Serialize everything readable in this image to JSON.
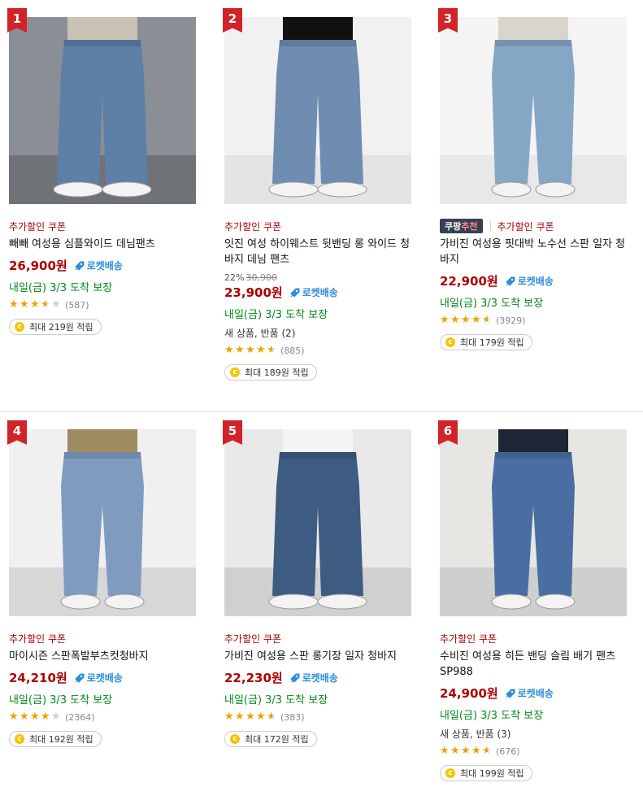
{
  "colors": {
    "rank_flag": "#d2232a",
    "coupon": "#ae0000",
    "price": "#ae0000",
    "rocket": "#2d8ed8",
    "arrive": "#00891a",
    "star": "#f0a100",
    "rec_badge": "#374151"
  },
  "products": [
    {
      "rank": "1",
      "coupon": "추가할인 쿠폰",
      "name": "빼빼 여성용 심플와이드 데님팬츠",
      "price": "26,900원",
      "rocket": "로켓배송",
      "arrive": "내일(금) 3/3 도착 보장",
      "rating": 3.5,
      "count": "(587)",
      "reward": "최대 219원 적립",
      "image": "wide-jeans-photo"
    },
    {
      "rank": "2",
      "coupon": "추가할인 쿠폰",
      "name": "잇진 여성 하이웨스트 뒷밴딩 롱 와이드 청바지 데님 팬츠",
      "discount": "22%",
      "orig_price": "30,900",
      "price": "23,900원",
      "rocket": "로켓배송",
      "arrive": "내일(금) 3/3 도착 보장",
      "new_prod": "새 상품, 반품 (2)",
      "rating": 4.5,
      "count": "(885)",
      "reward": "최대 189원 적립",
      "image": "highwaist-jeans-photo"
    },
    {
      "rank": "3",
      "rec": "쿠팡추천",
      "rec_a": "쿠팡",
      "rec_b": "추천",
      "coupon": "추가할인 쿠폰",
      "name": "가비진 여성용 핏대박 노수선 스판 일자 청바지",
      "price": "22,900원",
      "rocket": "로켓배송",
      "arrive": "내일(금) 3/3 도착 보장",
      "rating": 4.5,
      "count": "(3929)",
      "reward": "최대 179원 적립",
      "image": "straight-jeans-photo"
    },
    {
      "rank": "4",
      "coupon": "추가할인 쿠폰",
      "name": "마이시즌 스판폭발부츠컷청바지",
      "price": "24,210원",
      "rocket": "로켓배송",
      "arrive": "내일(금) 3/3 도착 보장",
      "rating": 4,
      "count": "(2364)",
      "reward": "최대 192원 적립",
      "image": "bootcut-jeans-photo"
    },
    {
      "rank": "5",
      "coupon": "추가할인 쿠폰",
      "name": "가비진 여성용 스판 롱기장 일자 청바지",
      "price": "22,230원",
      "rocket": "로켓배송",
      "arrive": "내일(금) 3/3 도착 보장",
      "rating": 4.5,
      "count": "(383)",
      "reward": "최대 172원 적립",
      "image": "long-jeans-photo"
    },
    {
      "rank": "6",
      "coupon": "추가할인 쿠폰",
      "name": "수비진 여성용 히든 밴딩 슬림 배기 팬츠 SP988",
      "price": "24,900원",
      "rocket": "로켓배송",
      "arrive": "내일(금) 3/3 도착 보장",
      "new_prod": "새 상품, 반품 (3)",
      "rating": 4.5,
      "count": "(676)",
      "reward": "최대 199원 적립",
      "image": "baggy-jeans-photo"
    }
  ]
}
